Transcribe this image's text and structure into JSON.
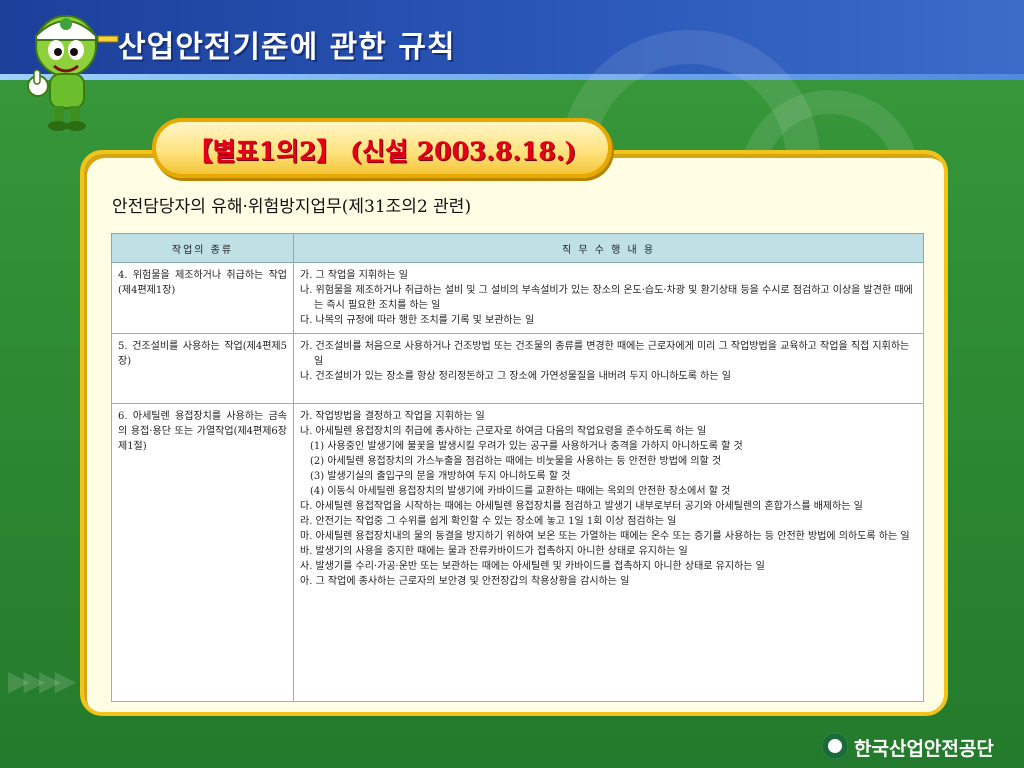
{
  "header": {
    "title": "산업안전기준에 관한 규칙"
  },
  "badge": {
    "text": "【별표1의2】 (신설 2003.8.18.)"
  },
  "subtitle": "안전담당자의 유해·위험방지업무(제31조의2 관련)",
  "table": {
    "headers": [
      "작업의 종류",
      "직 무 수 행 내 용"
    ],
    "rows": [
      {
        "work": "4. 위험물을 제조하거나 취급하는 작업(제4편제1장)",
        "duties": [
          {
            "text": "가. 그 작업을 지휘하는 일",
            "sub": false
          },
          {
            "text": "나. 위험물을 제조하거나 취급하는 설비 및 그 설비의 부속설비가 있는 장소의 온도·습도·차광 및 환기상태 등을 수시로 점검하고 이상을 발견한 때에는 즉시 필요한 조치를 하는 일",
            "sub": false
          },
          {
            "text": "다. 나목의 규정에 따라 행한 조치를 기록 및 보관하는 일",
            "sub": false
          }
        ]
      },
      {
        "work": "5. 건조설비를 사용하는 작업(제4편제5장)",
        "duties": [
          {
            "text": "가. 건조설비를 처음으로 사용하거나 건조방법 또는 건조물의 종류를 변경한 때에는 근로자에게 미리 그 작업방법을 교육하고 작업을 직접 지휘하는 일",
            "sub": false
          },
          {
            "text": "나. 건조설비가 있는 장소를 항상 정리정돈하고 그 장소에 가연성물질을 내버려 두지 아니하도록 하는 일",
            "sub": false
          }
        ]
      },
      {
        "work": "6. 아세틸렌 용접장치를 사용하는 금속의 용접·용단 또는 가열작업(제4편제6장제1절)",
        "duties": [
          {
            "text": "가. 작업방법을 결정하고 작업을 지휘하는 일",
            "sub": false
          },
          {
            "text": "나. 아세틸렌 용접장치의 취급에 종사하는 근로자로 하여금 다음의 작업요령을 준수하도록 하는 일",
            "sub": false
          },
          {
            "text": "(1) 사용중인 발생기에 불꽃을 발생시킬 우려가 있는 공구를 사용하거나 충격을 가하지 아니하도록 할 것",
            "sub": true
          },
          {
            "text": "(2) 아세틸렌 용접장치의 가스누출을 점검하는 때에는 비눗물을 사용하는 등 안전한 방법에 의할 것",
            "sub": true
          },
          {
            "text": "(3) 발생기실의 출입구의 문을 개방하여 두지 아니하도록 할 것",
            "sub": true
          },
          {
            "text": "(4) 이동식 아세틸렌 용접장치의 발생기에 카바이드를 교환하는 때에는 옥외의 안전한 장소에서 할 것",
            "sub": true
          },
          {
            "text": "다. 아세틸렌 용접작업을 시작하는 때에는 아세틸렌 용접장치를 점검하고 발생기 내부로부터 공기와 아세틸렌의 혼합가스를 배제하는 일",
            "sub": false
          },
          {
            "text": "라. 안전기는 작업중 그 수위를 쉽게 확인할 수 있는 장소에 놓고 1일 1회 이상 점검하는 일",
            "sub": false
          },
          {
            "text": "마. 아세틸렌 용접장치내의 물의 동결을 방지하기 위하여 보온 또는 가열하는 때에는 온수 또는 증기를 사용하는 등 안전한 방법에 의하도록 하는 일",
            "sub": false
          },
          {
            "text": "바. 발생기의 사용을 중지한 때에는 물과 잔류카바이드가 접촉하지 아니한 상태로 유지하는 일",
            "sub": false
          },
          {
            "text": "사. 발생기를 수리·가공·운반 또는 보관하는 때에는 아세틸렌 및 카바이드를 접촉하지 아니한 상태로 유지하는 일",
            "sub": false
          },
          {
            "text": "아. 그 작업에 종사하는 근로자의 보안경 및 안전장갑의 착용상황을 감시하는 일",
            "sub": false
          }
        ]
      }
    ]
  },
  "footer": {
    "logo_text": "한국산업안전공단"
  },
  "icons": {
    "mascot": "mascot-icon",
    "logo": "kosha-logo-icon"
  },
  "colors": {
    "header_blue": "#1c3f9a",
    "background_green": "#2f8d34",
    "frame_yellow": "#f2c318",
    "badge_red_text": "#e5001a",
    "table_header": "#bfe0e4"
  }
}
